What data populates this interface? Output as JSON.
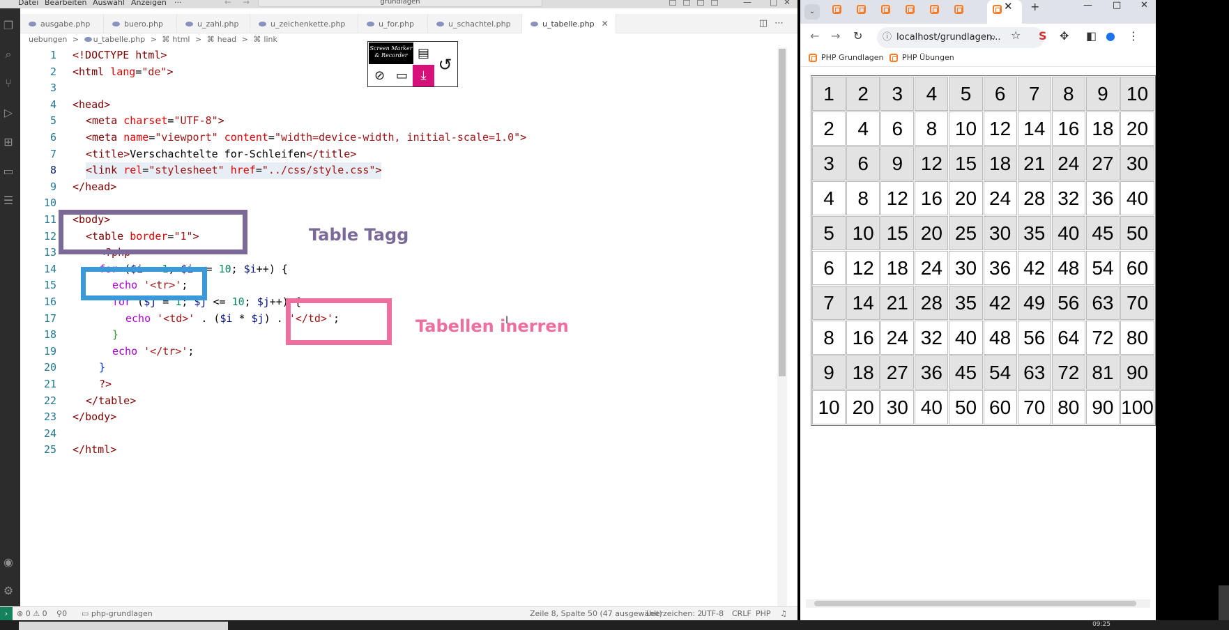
{
  "vscode": {
    "menu": [
      "Datei",
      "Bearbeiten",
      "Auswahl",
      "Anzeigen",
      "···"
    ],
    "command_center": "grundlagen",
    "tabs": [
      {
        "label": "ausgabe.php",
        "active": false
      },
      {
        "label": "buero.php",
        "active": false
      },
      {
        "label": "u_zahl.php",
        "active": false
      },
      {
        "label": "u_zeichenkette.php",
        "active": false
      },
      {
        "label": "u_for.php",
        "active": false
      },
      {
        "label": "u_schachtel.php",
        "active": false
      },
      {
        "label": "u_tabelle.php",
        "active": true
      }
    ],
    "breadcrumb": [
      "uebungen",
      ">",
      "u_tabelle.php",
      ">",
      "html",
      ">",
      "head",
      ">",
      "link"
    ],
    "line_numbers": [
      "1",
      "2",
      "3",
      "4",
      "5",
      "6",
      "7",
      "8",
      "9",
      "10",
      "11",
      "12",
      "13",
      "14",
      "15",
      "16",
      "17",
      "18",
      "19",
      "20",
      "21",
      "22",
      "23",
      "24",
      "25"
    ],
    "code": {
      "l1": [
        "<!DOCTYPE html>"
      ],
      "l2": [
        "<",
        "html",
        " ",
        "lang",
        "=",
        "\"de\"",
        ">"
      ],
      "l4": [
        "<",
        "head",
        ">"
      ],
      "l5": [
        "<",
        "meta",
        " ",
        "charset",
        "=",
        "\"UTF-8\"",
        ">"
      ],
      "l6": [
        "<",
        "meta",
        " ",
        "name",
        "=",
        "\"viewport\"",
        " ",
        "content",
        "=",
        "\"width=device-width, initial-scale=1.0\"",
        ">"
      ],
      "l7": [
        "<",
        "title",
        ">",
        "Verschachtelte for-Schleifen",
        "</",
        "title",
        ">"
      ],
      "l8": [
        "<",
        "link",
        " ",
        "rel",
        "=",
        "\"stylesheet\"",
        " ",
        "href",
        "=",
        "\"../css/style.css\"",
        ">"
      ],
      "l9": [
        "</",
        "head",
        ">"
      ],
      "l11": [
        "<",
        "body",
        ">"
      ],
      "l12": [
        "<",
        "table",
        " ",
        "border",
        "=",
        "\"1\"",
        ">"
      ],
      "l13": [
        "<?php"
      ],
      "l14": [
        "for",
        " (",
        "$i",
        " = ",
        "1",
        "; ",
        "$i",
        " <= ",
        "10",
        "; ",
        "$i",
        "++) {"
      ],
      "l15": [
        "echo",
        " ",
        "'<tr>'",
        ";"
      ],
      "l16": [
        "for",
        " (",
        "$j",
        " = ",
        "1",
        "; ",
        "$j",
        " <= ",
        "10",
        "; ",
        "$j",
        "++) {"
      ],
      "l17": [
        "echo",
        " ",
        "'<td>'",
        " . (",
        "$i",
        " * ",
        "$j",
        ") . ",
        "'</td>'",
        ";"
      ],
      "l18": [
        "}"
      ],
      "l19": [
        "echo",
        " ",
        "'</tr>'",
        ";"
      ],
      "l20": [
        "}"
      ],
      "l21": [
        "?>"
      ],
      "l22": [
        "</",
        "table",
        ">"
      ],
      "l23": [
        "</",
        "body",
        ">"
      ],
      "l25": [
        "</",
        "html",
        ">"
      ]
    },
    "annotations": {
      "table_tag": "Table Tagg",
      "table_inner": "Tabellen inerren",
      "purple": "#7b6a99",
      "blue": "#3a9ad9",
      "pink": "#ec6fa0"
    },
    "screen_marker": {
      "logo_line1": "Screen Marker",
      "logo_line2": "& Recorder"
    },
    "status": {
      "errors": "0",
      "warnings": "0",
      "ports": "0",
      "folder": "php-grundlagen",
      "position": "Zeile 8, Spalte 50 (47 ausgewählt)",
      "spaces": "Leerzeichen: 2",
      "encoding": "UTF-8",
      "eol": "CRLF",
      "language": "PHP"
    }
  },
  "chrome": {
    "url": "localhost/grundlagen...",
    "bookmarks": [
      "PHP Grundlagen",
      "PHP Übungen"
    ],
    "table": [
      [
        "1",
        "2",
        "3",
        "4",
        "5",
        "6",
        "7",
        "8",
        "9",
        "10"
      ],
      [
        "2",
        "4",
        "6",
        "8",
        "10",
        "12",
        "14",
        "16",
        "18",
        "20"
      ],
      [
        "3",
        "6",
        "9",
        "12",
        "15",
        "18",
        "21",
        "24",
        "27",
        "30"
      ],
      [
        "4",
        "8",
        "12",
        "16",
        "20",
        "24",
        "28",
        "32",
        "36",
        "40"
      ],
      [
        "5",
        "10",
        "15",
        "20",
        "25",
        "30",
        "35",
        "40",
        "45",
        "50"
      ],
      [
        "6",
        "12",
        "18",
        "24",
        "30",
        "36",
        "42",
        "48",
        "54",
        "60"
      ],
      [
        "7",
        "14",
        "21",
        "28",
        "35",
        "42",
        "49",
        "56",
        "63",
        "70"
      ],
      [
        "8",
        "16",
        "24",
        "32",
        "40",
        "48",
        "56",
        "64",
        "72",
        "80"
      ],
      [
        "9",
        "18",
        "27",
        "36",
        "45",
        "54",
        "63",
        "72",
        "81",
        "90"
      ],
      [
        "10",
        "20",
        "30",
        "40",
        "50",
        "60",
        "70",
        "80",
        "90",
        "100"
      ]
    ]
  },
  "taskbar": {
    "time": "09:25"
  }
}
